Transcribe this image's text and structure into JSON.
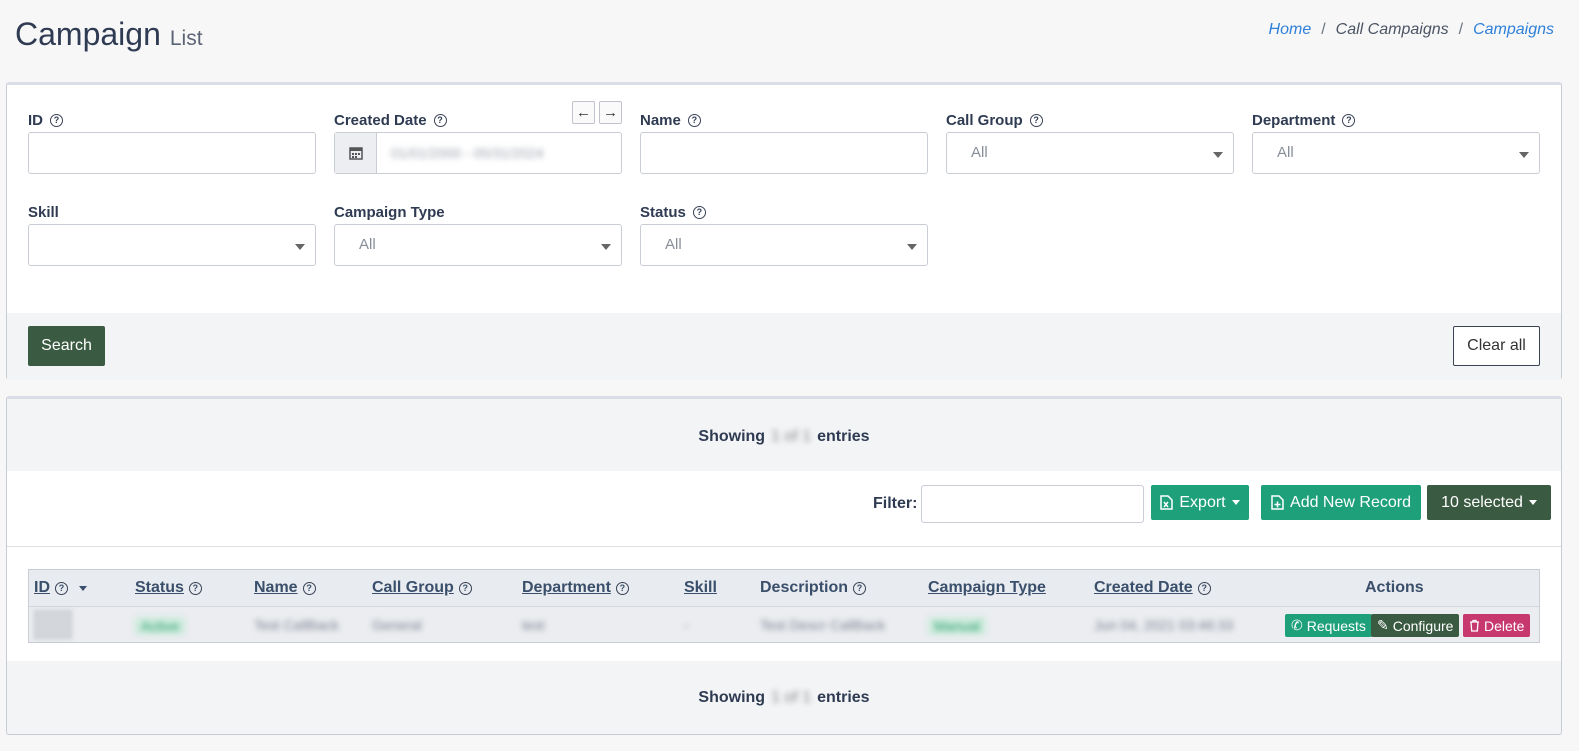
{
  "header": {
    "title": "Campaign",
    "subtitle": "List",
    "breadcrumb": [
      "Home",
      "Call Campaigns",
      "Campaigns"
    ]
  },
  "filters": {
    "id": {
      "label": "ID",
      "value": ""
    },
    "created_date": {
      "label": "Created Date",
      "value": "01/01/2000 - 05/31/2024"
    },
    "name": {
      "label": "Name",
      "value": ""
    },
    "call_group": {
      "label": "Call Group",
      "value": "All"
    },
    "department": {
      "label": "Department",
      "value": "All"
    },
    "skill": {
      "label": "Skill",
      "value": ""
    },
    "campaign_type": {
      "label": "Campaign Type",
      "value": "All"
    },
    "status": {
      "label": "Status",
      "value": "All"
    },
    "search_label": "Search",
    "clear_label": "Clear all"
  },
  "list": {
    "showing_prefix": "Showing",
    "showing_count": "1 of 1",
    "showing_suffix": "entries",
    "filter_label": "Filter:",
    "filter_value": "",
    "export_label": "Export",
    "add_label": "Add New Record",
    "selected_label": "10 selected",
    "columns": {
      "id": "ID",
      "status": "Status",
      "name": "Name",
      "call_group": "Call Group",
      "department": "Department",
      "skill": "Skill",
      "description": "Description",
      "campaign_type": "Campaign Type",
      "created_date": "Created Date",
      "actions": "Actions"
    },
    "rows": [
      {
        "status": "Active",
        "name": "Test CallBack",
        "call_group": "General",
        "department": "test",
        "skill": "-",
        "description": "Test Descr CallBack",
        "campaign_type": "Manual",
        "created_date": "Jun 04, 2021 03:46:33",
        "actions": {
          "requests": "Requests",
          "configure": "Configure",
          "delete": "Delete"
        }
      }
    ]
  },
  "colors": {
    "primary_dark": "#3b5a42",
    "accent_green": "#1ea07a",
    "danger": "#c7386f",
    "link": "#2f80d9"
  }
}
